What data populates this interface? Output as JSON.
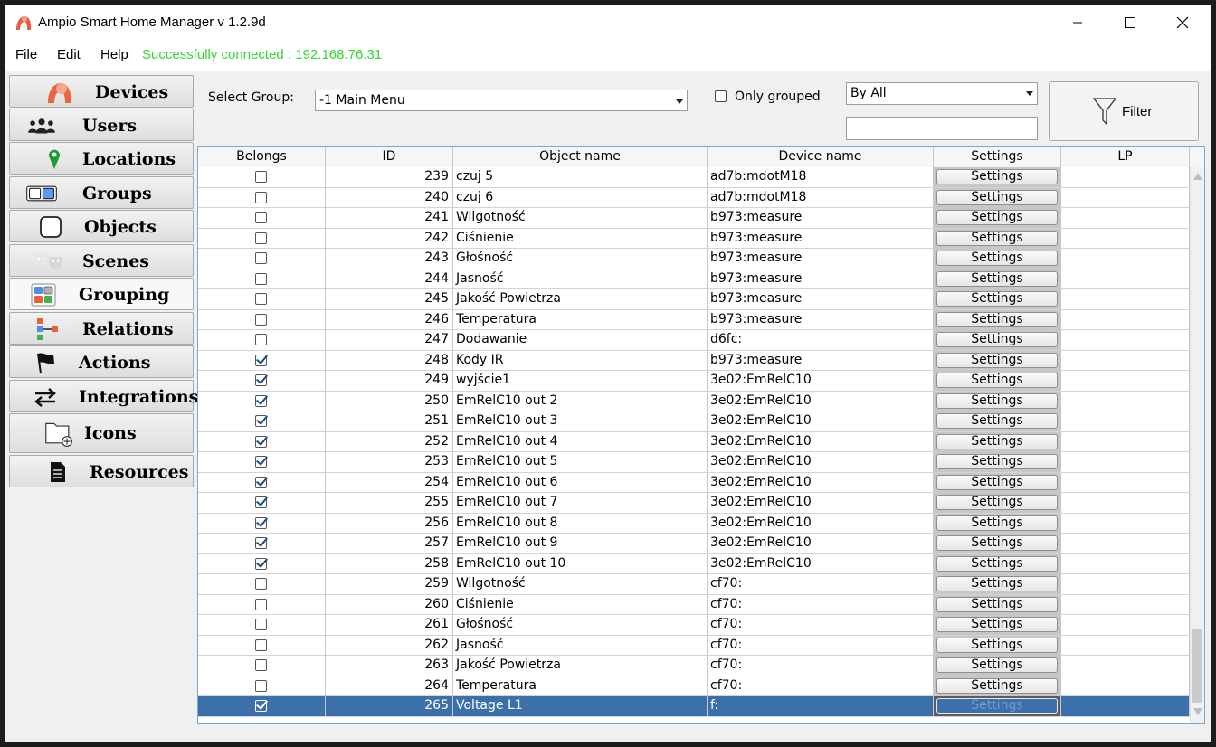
{
  "window": {
    "title": "Ampio Smart Home Manager v 1.2.9d",
    "controls": {
      "minimize": "minimize",
      "maximize": "maximize",
      "close": "close"
    }
  },
  "menu": {
    "file": "File",
    "edit": "Edit",
    "help": "Help",
    "status": "Successfully connected : 192.168.76.31",
    "status_color": "#33d533"
  },
  "sidebar": {
    "items": [
      {
        "label": "Devices",
        "icon": "devices-icon"
      },
      {
        "label": "Users",
        "icon": "users-icon"
      },
      {
        "label": "Locations",
        "icon": "location-pin-icon"
      },
      {
        "label": "Groups",
        "icon": "groups-icon"
      },
      {
        "label": "Objects",
        "icon": "objects-icon"
      },
      {
        "label": "Scenes",
        "icon": "theater-masks-icon"
      },
      {
        "label": "Grouping",
        "icon": "grouping-icon",
        "active": true
      },
      {
        "label": "Relations",
        "icon": "relations-icon"
      },
      {
        "label": "Actions",
        "icon": "flag-icon"
      },
      {
        "label": "Integrations",
        "icon": "arrows-exchange-icon"
      },
      {
        "label": "Icons",
        "icon": "folder-add-icon"
      },
      {
        "label": "Resources",
        "icon": "document-icon"
      }
    ]
  },
  "filter": {
    "select_group_label": "Select Group:",
    "select_group_value": "-1 Main Menu",
    "only_grouped_label": "Only grouped",
    "only_grouped_checked": false,
    "by_all_value": "By All",
    "filter_text_value": "",
    "filter_button_label": "Filter"
  },
  "table": {
    "columns": [
      "Belongs",
      "ID",
      "Object name",
      "Device name",
      "Settings",
      "LP"
    ],
    "settings_label": "Settings",
    "rows": [
      {
        "belongs": false,
        "id": "239",
        "object": " czuj 5",
        "device": "ad7b:mdotM18",
        "lp": ""
      },
      {
        "belongs": false,
        "id": "240",
        "object": " czuj 6",
        "device": "ad7b:mdotM18",
        "lp": ""
      },
      {
        "belongs": false,
        "id": "241",
        "object": "Wilgotność",
        "device": "b973:measure",
        "lp": ""
      },
      {
        "belongs": false,
        "id": "242",
        "object": "Ciśnienie",
        "device": "b973:measure",
        "lp": ""
      },
      {
        "belongs": false,
        "id": "243",
        "object": "Głośność",
        "device": "b973:measure",
        "lp": ""
      },
      {
        "belongs": false,
        "id": "244",
        "object": "Jasność",
        "device": "b973:measure",
        "lp": ""
      },
      {
        "belongs": false,
        "id": "245",
        "object": "Jakość Powietrza",
        "device": "b973:measure",
        "lp": ""
      },
      {
        "belongs": false,
        "id": "246",
        "object": "Temperatura",
        "device": "b973:measure",
        "lp": ""
      },
      {
        "belongs": false,
        "id": "247",
        "object": "Dodawanie",
        "device": "d6fc:",
        "lp": ""
      },
      {
        "belongs": true,
        "id": "248",
        "object": "Kody IR",
        "device": "b973:measure",
        "lp": ""
      },
      {
        "belongs": true,
        "id": "249",
        "object": "wyjście1",
        "device": "3e02:EmRelC10",
        "lp": ""
      },
      {
        "belongs": true,
        "id": "250",
        "object": "EmRelC10 out 2",
        "device": "3e02:EmRelC10",
        "lp": ""
      },
      {
        "belongs": true,
        "id": "251",
        "object": "EmRelC10 out 3",
        "device": "3e02:EmRelC10",
        "lp": ""
      },
      {
        "belongs": true,
        "id": "252",
        "object": "EmRelC10 out 4",
        "device": "3e02:EmRelC10",
        "lp": ""
      },
      {
        "belongs": true,
        "id": "253",
        "object": "EmRelC10 out 5",
        "device": "3e02:EmRelC10",
        "lp": ""
      },
      {
        "belongs": true,
        "id": "254",
        "object": "EmRelC10 out 6",
        "device": "3e02:EmRelC10",
        "lp": ""
      },
      {
        "belongs": true,
        "id": "255",
        "object": "EmRelC10 out 7",
        "device": "3e02:EmRelC10",
        "lp": ""
      },
      {
        "belongs": true,
        "id": "256",
        "object": "EmRelC10 out 8",
        "device": "3e02:EmRelC10",
        "lp": ""
      },
      {
        "belongs": true,
        "id": "257",
        "object": "EmRelC10 out 9",
        "device": "3e02:EmRelC10",
        "lp": ""
      },
      {
        "belongs": true,
        "id": "258",
        "object": "EmRelC10 out 10",
        "device": "3e02:EmRelC10",
        "lp": ""
      },
      {
        "belongs": false,
        "id": "259",
        "object": "Wilgotność",
        "device": "cf70:",
        "lp": ""
      },
      {
        "belongs": false,
        "id": "260",
        "object": "Ciśnienie",
        "device": "cf70:",
        "lp": ""
      },
      {
        "belongs": false,
        "id": "261",
        "object": "Głośność",
        "device": "cf70:",
        "lp": ""
      },
      {
        "belongs": false,
        "id": "262",
        "object": "Jasność",
        "device": "cf70:",
        "lp": ""
      },
      {
        "belongs": false,
        "id": "263",
        "object": "Jakość Powietrza",
        "device": "cf70:",
        "lp": ""
      },
      {
        "belongs": false,
        "id": "264",
        "object": "Temperatura",
        "device": "cf70:",
        "lp": ""
      },
      {
        "belongs": true,
        "id": "265",
        "object": "Voltage L1",
        "device": "f:",
        "lp": "",
        "selected": true
      }
    ]
  }
}
